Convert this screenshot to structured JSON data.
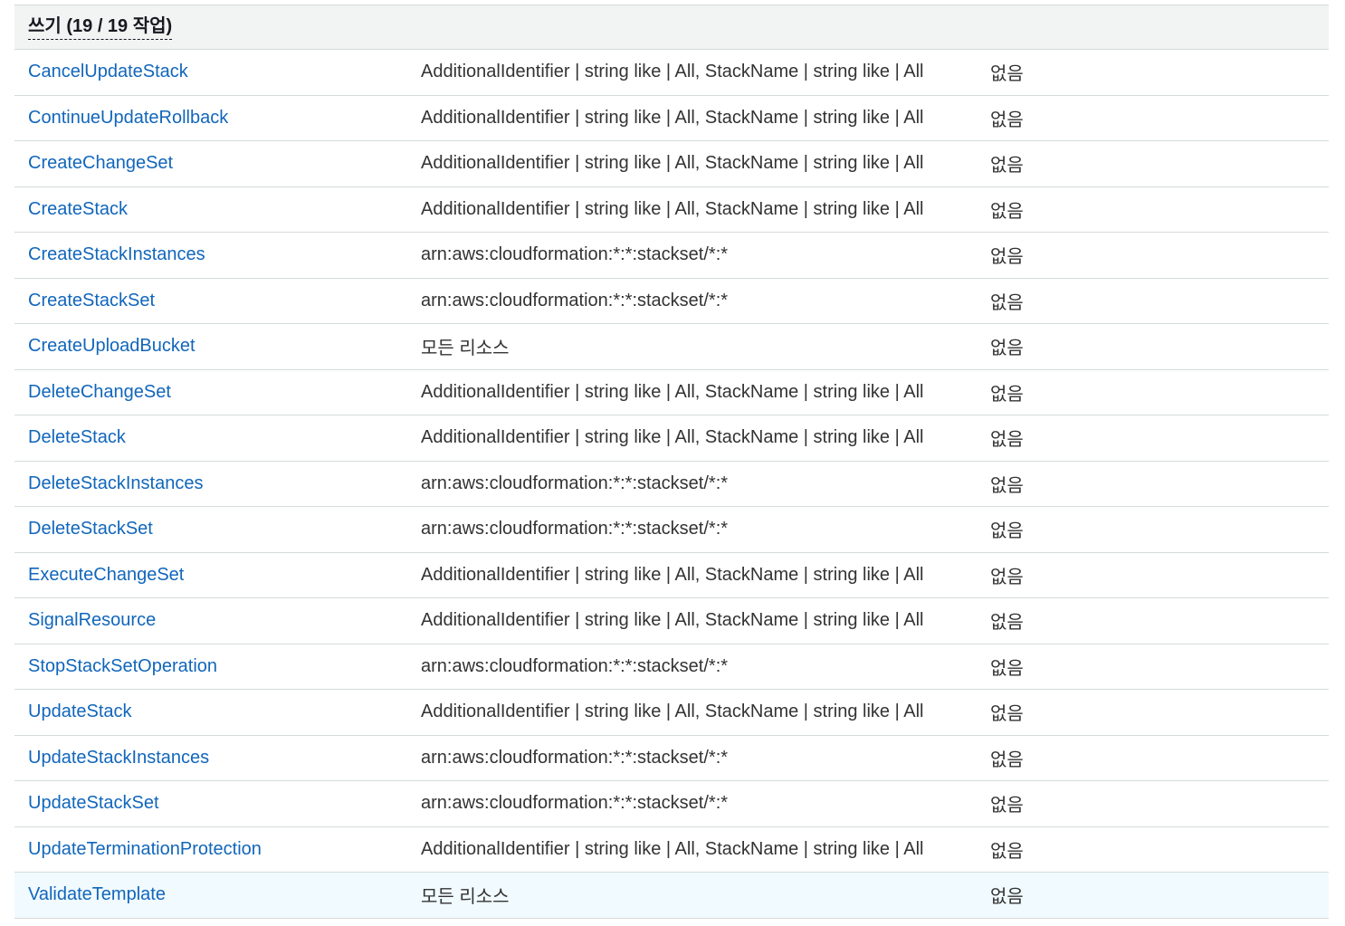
{
  "group": {
    "title": "쓰기 (19 / 19 작업)"
  },
  "rows": [
    {
      "action": "CancelUpdateStack",
      "resource": "AdditionalIdentifier | string like | All, StackName | string like | All",
      "dependent": "없음"
    },
    {
      "action": "ContinueUpdateRollback",
      "resource": "AdditionalIdentifier | string like | All, StackName | string like | All",
      "dependent": "없음"
    },
    {
      "action": "CreateChangeSet",
      "resource": "AdditionalIdentifier | string like | All, StackName | string like | All",
      "dependent": "없음"
    },
    {
      "action": "CreateStack",
      "resource": "AdditionalIdentifier | string like | All, StackName | string like | All",
      "dependent": "없음"
    },
    {
      "action": "CreateStackInstances",
      "resource": "arn:aws:cloudformation:*:*:stackset/*:*",
      "dependent": "없음"
    },
    {
      "action": "CreateStackSet",
      "resource": "arn:aws:cloudformation:*:*:stackset/*:*",
      "dependent": "없음"
    },
    {
      "action": "CreateUploadBucket",
      "resource": "모든 리소스",
      "dependent": "없음"
    },
    {
      "action": "DeleteChangeSet",
      "resource": "AdditionalIdentifier | string like | All, StackName | string like | All",
      "dependent": "없음"
    },
    {
      "action": "DeleteStack",
      "resource": "AdditionalIdentifier | string like | All, StackName | string like | All",
      "dependent": "없음"
    },
    {
      "action": "DeleteStackInstances",
      "resource": "arn:aws:cloudformation:*:*:stackset/*:*",
      "dependent": "없음"
    },
    {
      "action": "DeleteStackSet",
      "resource": "arn:aws:cloudformation:*:*:stackset/*:*",
      "dependent": "없음"
    },
    {
      "action": "ExecuteChangeSet",
      "resource": "AdditionalIdentifier | string like | All, StackName | string like | All",
      "dependent": "없음"
    },
    {
      "action": "SignalResource",
      "resource": "AdditionalIdentifier | string like | All, StackName | string like | All",
      "dependent": "없음"
    },
    {
      "action": "StopStackSetOperation",
      "resource": "arn:aws:cloudformation:*:*:stackset/*:*",
      "dependent": "없음"
    },
    {
      "action": "UpdateStack",
      "resource": "AdditionalIdentifier | string like | All, StackName | string like | All",
      "dependent": "없음"
    },
    {
      "action": "UpdateStackInstances",
      "resource": "arn:aws:cloudformation:*:*:stackset/*:*",
      "dependent": "없음"
    },
    {
      "action": "UpdateStackSet",
      "resource": "arn:aws:cloudformation:*:*:stackset/*:*",
      "dependent": "없음"
    },
    {
      "action": "UpdateTerminationProtection",
      "resource": "AdditionalIdentifier | string like | All, StackName | string like | All",
      "dependent": "없음"
    },
    {
      "action": "ValidateTemplate",
      "resource": "모든 리소스",
      "dependent": "없음",
      "highlighted": true
    }
  ],
  "colors": {
    "link": "#1166bb",
    "header_bg": "#f2f3f3",
    "highlight_bg": "#f1faff",
    "border": "#d5dbdb"
  }
}
